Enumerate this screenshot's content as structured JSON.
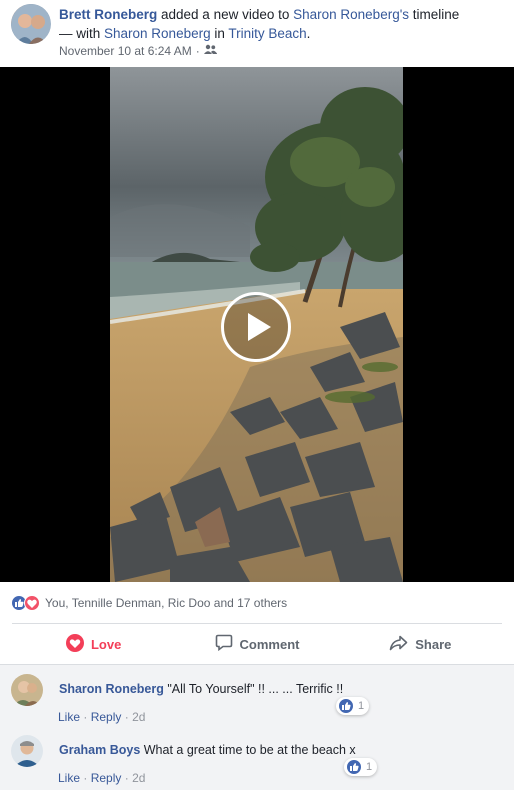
{
  "post": {
    "author": "Brett Roneberg",
    "action_text": " added a new video to ",
    "target": "Sharon Roneberg's",
    "timeline_word": " timeline",
    "with_text": "— with ",
    "tagged": "Sharon Roneberg",
    "in_text": " in ",
    "location": "Trinity Beach",
    "period": ".",
    "timestamp": "November 10 at 6:24 AM",
    "dot": "·",
    "audience_icon": "friends-icon"
  },
  "video": {
    "play_icon": "play-icon"
  },
  "reactions": {
    "icons": [
      "like-icon",
      "love-icon"
    ],
    "summary": "You, Tennille Denman, Ric Doo and 17 others"
  },
  "actions": {
    "love": "Love",
    "comment": "Comment",
    "share": "Share",
    "love_color": "#f33e58",
    "like_color": "#4267b2"
  },
  "comments": [
    {
      "name": "Sharon Roneberg",
      "text": " \"All To Yourself\" !! ... ... Terrific !!",
      "like": "Like",
      "reply": "Reply",
      "sep": "·",
      "time": "2d",
      "reaction_count": "1"
    },
    {
      "name": "Graham Boys",
      "text": " What a great time to be at the beach x",
      "like": "Like",
      "reply": "Reply",
      "sep": "·",
      "time": "2d",
      "reaction_count": "1"
    }
  ]
}
